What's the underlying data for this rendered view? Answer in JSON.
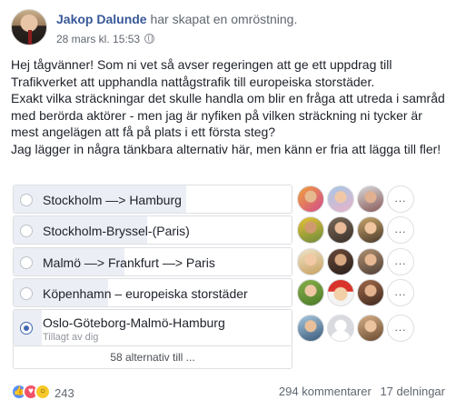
{
  "post": {
    "author": "Jakop Dalunde",
    "action": "har skapat en omröstning.",
    "timestamp": "28 mars kl. 15:53",
    "body_lines": [
      "Hej tågvänner! Som ni vet så avser regeringen att ge ett uppdrag till Trafikverket att upphandla nattågstrafik till europeiska storstäder.",
      "Exakt vilka sträckningar det skulle handla om blir en fråga att utreda i samråd med berörda aktörer - men jag är nyfiken på vilken sträckning ni tycker är mest angelägen att få på plats i ett första steg?",
      "Jag lägger in några tänkbara alternativ här, men känn er fria att lägga till fler!"
    ]
  },
  "poll": {
    "options": [
      {
        "label": "Stockholm —> Hamburg",
        "selected": false,
        "share": 0.62,
        "voters": [
          "voter-avatar",
          "voter-avatar",
          "voter-avatar"
        ]
      },
      {
        "label": "Stockholm-Bryssel-(Paris)",
        "selected": false,
        "share": 0.48,
        "voters": [
          "voter-avatar",
          "voter-avatar",
          "voter-avatar"
        ]
      },
      {
        "label": "Malmö —> Frankfurt —> Paris",
        "selected": false,
        "share": 0.4,
        "voters": [
          "voter-avatar",
          "voter-avatar",
          "voter-avatar"
        ]
      },
      {
        "label": "Köpenhamn – europeiska storstäder",
        "selected": false,
        "share": 0.34,
        "voters": [
          "voter-avatar",
          "voter-avatar",
          "voter-avatar"
        ]
      },
      {
        "label": "Oslo-Göteborg-Malmö-Hamburg",
        "sublabel": "Tillagt av dig",
        "selected": true,
        "share": 0.1,
        "voters": [
          "voter-avatar",
          "voter-avatar",
          "voter-avatar"
        ]
      }
    ],
    "more_button": "...",
    "more_options": "58 alternativ till ..."
  },
  "footer": {
    "reactions": [
      "like-icon",
      "love-icon",
      "wow-icon"
    ],
    "reaction_count": "243",
    "comments": "294 kommentarer",
    "shares": "17 delningar"
  },
  "colors": {
    "author": "#385898",
    "fill": "#ebeef4",
    "radio_checked": "#4267b2",
    "like": "#5890ff",
    "love": "#f25268",
    "wow": "#f7c928"
  }
}
